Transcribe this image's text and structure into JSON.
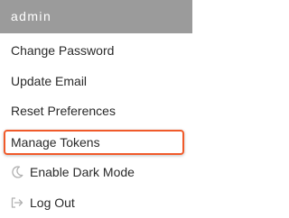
{
  "menu": {
    "header": "admin",
    "items": [
      {
        "label": "Change Password",
        "icon": null
      },
      {
        "label": "Update Email",
        "icon": null
      },
      {
        "label": "Reset Preferences",
        "icon": null
      },
      {
        "label": "Manage Tokens",
        "icon": null,
        "highlighted": true
      },
      {
        "label": "Enable Dark Mode",
        "icon": "moon-icon"
      },
      {
        "label": "Log Out",
        "icon": "logout-icon"
      }
    ]
  },
  "colors": {
    "header_bg": "#9b9b9b",
    "highlight_border": "#f05a2a",
    "text": "#2a2a2a",
    "icon": "#b0b0b0"
  }
}
